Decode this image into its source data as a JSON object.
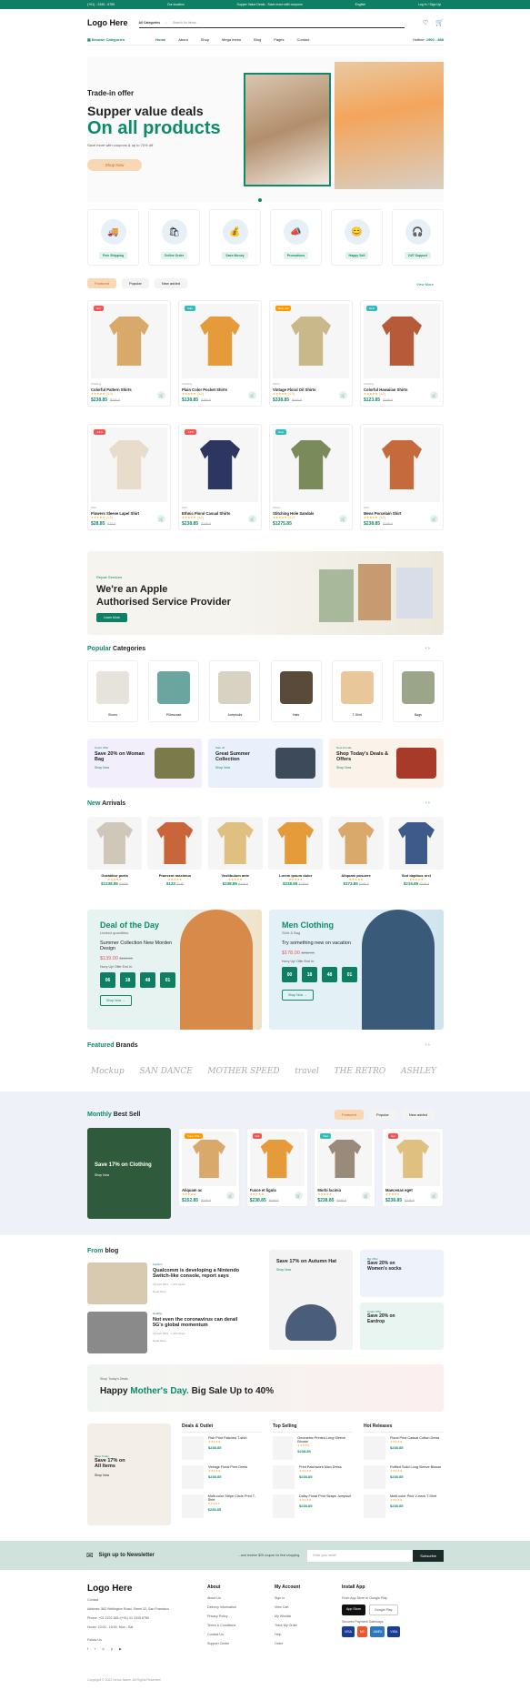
{
  "topbar": {
    "phone": "(+01) - 2345 - 6789",
    "location": "Our location",
    "promo": "Supper Value Deals - Save more with coupons",
    "lang": "English",
    "login": "Log In / Sign Up"
  },
  "header": {
    "logo": "Logo Here",
    "category": "All Categories",
    "search_placeholder": "Search for items...",
    "browse": "Browse Categories",
    "hotline_label": "Hotline:",
    "hotline": "1900 - 888"
  },
  "nav": [
    "Home",
    "About",
    "Shop",
    "Mega menu",
    "Blog",
    "Pages",
    "Contact"
  ],
  "hero": {
    "pre": "Trade-in offer",
    "title": "Supper value deals",
    "title2": "On all products",
    "sub": "Save more with coupons & up to 70% off",
    "button": "Shop Now"
  },
  "features": [
    "Free Shipping",
    "Online Order",
    "Save Money",
    "Promotions",
    "Happy Sell",
    "24/7 Support"
  ],
  "featured": {
    "tabs": [
      "Featured",
      "Popular",
      "New added"
    ],
    "view_more": "View More",
    "products": [
      {
        "badge": "Hot",
        "cat": "Clothing",
        "name": "Colorful Pattern Shirts",
        "rating": "(4.0)",
        "price": "$238.85",
        "old": "$245.8",
        "color": "#e55"
      },
      {
        "badge": "Sale",
        "cat": "Clothing",
        "name": "Plain Color Pocket Shirts",
        "rating": "(4.0)",
        "price": "$138.85",
        "old": "$255.8",
        "color": "#3bb"
      },
      {
        "badge": "Best sell",
        "cat": "Shirts",
        "name": "Vintage Floral Oil Shirts",
        "rating": "(4.0)",
        "price": "$338.85",
        "old": "$445.8",
        "color": "#f90"
      },
      {
        "badge": "New",
        "cat": "Clothing",
        "name": "Colorful Hawaiian Shirts",
        "rating": "(4.0)",
        "price": "$123.85",
        "old": "$235.8",
        "color": "#3bb"
      },
      {
        "badge": "-14%",
        "cat": "Shirt",
        "name": "Flowers Sleeve Lapel Shirt",
        "rating": "(4.0)",
        "price": "$28.85",
        "old": "$32.8",
        "color": "#e55"
      },
      {
        "badge": "-14%",
        "cat": "Shirt",
        "name": "Ethnic Floral Casual Shirts",
        "rating": "(4.0)",
        "price": "$238.85",
        "old": "$245.8",
        "color": "#e55"
      },
      {
        "badge": "New",
        "cat": "Shoes",
        "name": "Stitching Hole Sandals",
        "rating": "(4.0)",
        "price": "$1275.85",
        "old": "",
        "color": "#3bb"
      },
      {
        "badge": "",
        "cat": "Shirt",
        "name": "Mens Porcelain Shirt",
        "rating": "(4.0)",
        "price": "$238.85",
        "old": "$245.8",
        "color": "#e55"
      }
    ]
  },
  "repair": {
    "label": "Repair Services",
    "title": "We're an Apple",
    "title2": "Authorised Service Provider",
    "button": "Learn More"
  },
  "popular": {
    "title_a": "Popular",
    "title_b": "Categories",
    "items": [
      "Shoes",
      "Pillowcase",
      "Jumpsuits",
      "Hats",
      "T-Shirt",
      "Bags"
    ]
  },
  "promos": [
    {
      "small": "Smart Offer",
      "title": "Save 20% on Woman Bag",
      "link": "Shop Now"
    },
    {
      "small": "Sale off",
      "title": "Great Summer Collection",
      "link": "Shop Now"
    },
    {
      "small": "New Arrivals",
      "title": "Shop Today's Deals & Offers",
      "link": "Shop Now"
    }
  ],
  "arrivals": {
    "title_a": "New",
    "title_b": "Arrivals",
    "items": [
      {
        "name": "Gurabitur porta",
        "price": "$1238.85",
        "old": "$2455"
      },
      {
        "name": "Praesent maximus",
        "price": "$123",
        "old": "$245"
      },
      {
        "name": "Vestibulum ante",
        "price": "$238.85",
        "old": "$245.8"
      },
      {
        "name": "Lorem ipsum dolor",
        "price": "$238.85",
        "old": "$245.8"
      },
      {
        "name": "Aliquam posuere",
        "price": "$173.85",
        "old": "$245.8"
      },
      {
        "name": "Sed dapibus orci",
        "price": "$215.85",
        "old": "$245.8"
      }
    ]
  },
  "deals": [
    {
      "title": "Deal of the Day",
      "sub": "Limited quantities.",
      "desc": "Summer Collection New Morden Design",
      "price": "$139.00",
      "old": "$160.99",
      "hurry": "Hurry Up! Offer End In:",
      "timer": [
        "06",
        "18",
        "48",
        "01"
      ],
      "button": "Shop Now"
    },
    {
      "title": "Men Clothing",
      "sub": "Shirt & Bag",
      "desc": "Try something new on vacation",
      "price": "$178.00",
      "old": "$256.99",
      "hurry": "Hurry Up! Offer End In:",
      "timer": [
        "00",
        "18",
        "48",
        "01"
      ],
      "button": "Shop Now"
    }
  ],
  "brands": {
    "title_a": "Featured",
    "title_b": "Brands",
    "items": [
      "Mockup",
      "SAN DANCE",
      "MOTHER SPEED",
      "travel",
      "THE RETRO",
      "ASHLEY"
    ]
  },
  "monthly": {
    "title_a": "Monthly",
    "title_b": "Best Sell",
    "tabs": [
      "Featured",
      "Popular",
      "New added"
    ],
    "banner": "Save 17% on Clothing",
    "banner_btn": "Shop Now",
    "items": [
      {
        "badge": "Save 15%",
        "name": "Aliquam ac",
        "price": "$152.85",
        "old": "$245.8"
      },
      {
        "badge": "Hot",
        "name": "Fusce et ligula",
        "price": "$238.85",
        "old": "$245.8"
      },
      {
        "badge": "New",
        "name": "Morbi lacinia",
        "price": "$238.85",
        "old": "$245.8"
      },
      {
        "badge": "Hot",
        "name": "Maecenas eget",
        "price": "$238.85",
        "old": "$245.8"
      }
    ]
  },
  "blog": {
    "title_a": "From",
    "title_b": "blog",
    "posts": [
      {
        "cat": "Fashion",
        "title": "Qualcomm is developing a Nintendo Switch-like console, report says",
        "meta": "14 April 2021 · 1.2M Views",
        "more": "Read More"
      },
      {
        "cat": "Healthy",
        "title": "Not even the coronavirus can derail 5G's global momentum",
        "meta": "14 April 2021 · 1.2M Views",
        "more": "Read More"
      }
    ],
    "banner": "Save 17% on Autumn Hat",
    "banner_btn": "Shop Now",
    "side": [
      {
        "small": "Big Offer",
        "title": "Save 20% on Women's socks"
      },
      {
        "small": "Smart Offer",
        "title": "Save 20% on Eardrop"
      }
    ]
  },
  "mothers": {
    "small": "Shop Today's Deals",
    "title_a": "Happy",
    "title_b": "Mother's Day.",
    "title_c": "Big Sale Up to 40%"
  },
  "bottom": {
    "banner": "Save 17% on All Items",
    "banner_small": "Shop Today",
    "banner_btn": "Shop Now",
    "cols": [
      {
        "title": "Deals & Outlet",
        "items": [
          {
            "name": "Fish Print Patched T-shirt",
            "price": "$238.85"
          },
          {
            "name": "Vintage Floral Print Dress",
            "price": "$238.85"
          },
          {
            "name": "Multi-color Stripe Circle Print T-Shirt",
            "price": "$238.85"
          }
        ]
      },
      {
        "title": "Top Selling",
        "items": [
          {
            "name": "Geometric Printed Long Sleeve Blouse",
            "price": "$238.85"
          },
          {
            "name": "Print Patchwork Maxi Dress",
            "price": "$238.85"
          },
          {
            "name": "Daisy Floral Print Straps Jumpsuit",
            "price": "$238.85"
          }
        ]
      },
      {
        "title": "Hot Releases",
        "items": [
          {
            "name": "Floral Print Casual Cotton Dress",
            "price": "$238.85"
          },
          {
            "name": "Ruffled Solid Long Sleeve Blouse",
            "price": "$238.85"
          },
          {
            "name": "Multi-color Print V-neck T-Shirt",
            "price": "$238.85"
          }
        ]
      }
    ]
  },
  "newsletter": {
    "title": "Sign up to Newsletter",
    "sub": "...and receive $25 coupon for first shopping.",
    "placeholder": "Enter your email",
    "button": "Subscribe"
  },
  "footer": {
    "logo": "Logo Here",
    "contact_title": "Contact",
    "address": "Address: 562 Wellington Road, Street 32, San Francisco",
    "phone": "Phone: +01 2222 365 /(+91) 01 2345 6789",
    "hours": "Hours: 10:00 - 18:00, Mon - Sat",
    "follow": "Follow Us",
    "about": {
      "title": "About",
      "links": [
        "About Us",
        "Delivery Information",
        "Privacy Policy",
        "Terms & Conditions",
        "Contact Us",
        "Support Center"
      ]
    },
    "account": {
      "title": "My Account",
      "links": [
        "Sign In",
        "View Cart",
        "My Wishlist",
        "Track My Order",
        "Help",
        "Order"
      ]
    },
    "app": {
      "title": "Install App",
      "sub": "From App Store or Google Play",
      "appstore": "App Store",
      "gplay": "Google Play",
      "secured": "Secured Payment Gateways",
      "cards": [
        "VISA",
        "MC",
        "AMEX",
        "VISA"
      ]
    },
    "copyright": "Copyright © 2022 Demo Name. All Rights Reserved"
  },
  "colors": {
    "accent": "#0e8a6b",
    "orange": "#f8d7b4",
    "hot": "#e55"
  }
}
